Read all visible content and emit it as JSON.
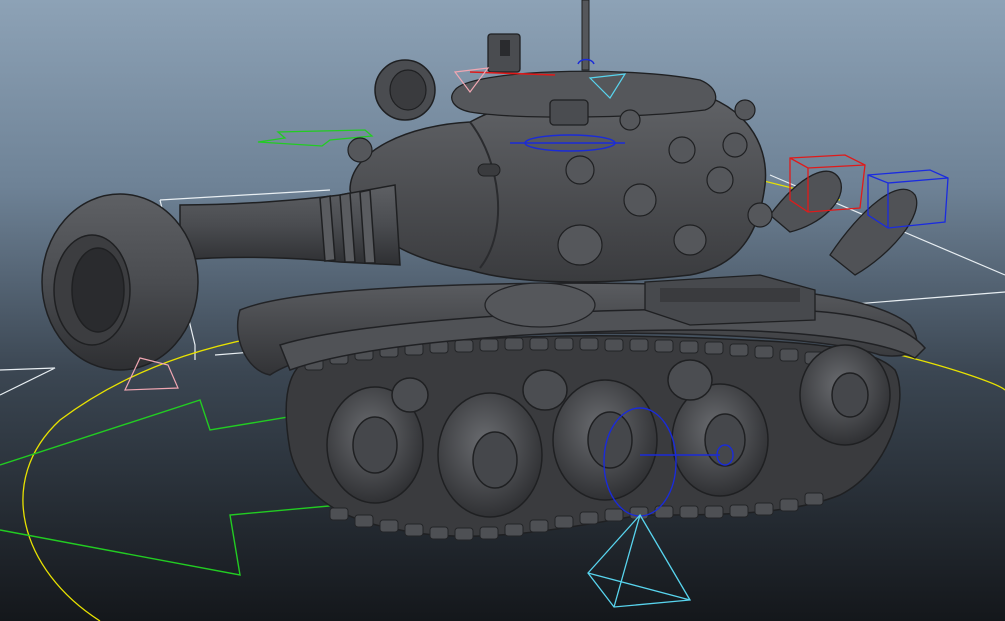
{
  "viewport": {
    "background_top": "#8da2b6",
    "background_bottom": "#14171b"
  },
  "model": {
    "shading_color": "#4a4c50",
    "highlight_color": "#6b6d71",
    "shadow_color": "#2a2b2e"
  },
  "rig": {
    "circle_control_color": "#e8e200",
    "control_curve_color": "#22cc22",
    "joint_control_color": "#1a2bd8",
    "locator_red_color": "#e01a1a",
    "locator_blue_color": "#1a2be0",
    "locator_cyan_color": "#58d4ee",
    "locator_pink_color": "#f0a6b2",
    "grid_line_color": "#e8eef2"
  }
}
